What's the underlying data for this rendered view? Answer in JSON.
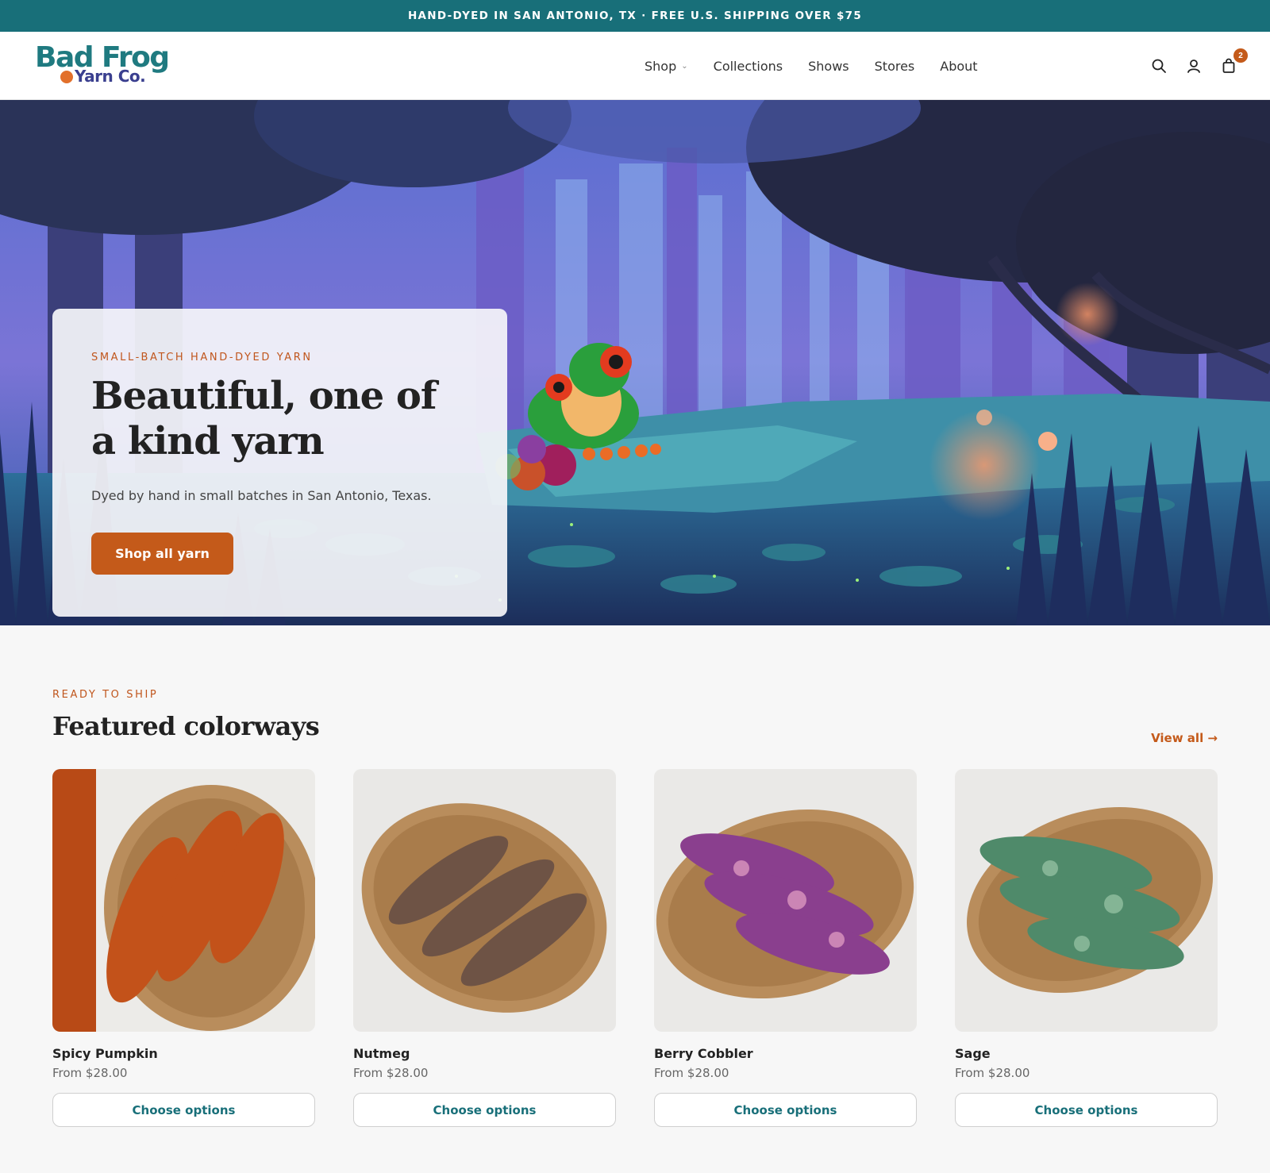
{
  "announcement": "HAND-DYED IN SAN ANTONIO, TX · FREE U.S. SHIPPING OVER $75",
  "brand": {
    "line1": "Bad Frog",
    "line2": "Yarn Co."
  },
  "nav": {
    "items": [
      {
        "label": "Shop",
        "has_dropdown": true
      },
      {
        "label": "Collections"
      },
      {
        "label": "Shows"
      },
      {
        "label": "Stores"
      },
      {
        "label": "About"
      }
    ]
  },
  "header_icons": {
    "search": "search-icon",
    "account": "user-icon",
    "cart": "bag-icon",
    "cart_count": "2"
  },
  "hero": {
    "eyebrow": "SMALL-BATCH HAND-DYED YARN",
    "title": "Beautiful, one of a kind yarn",
    "subtitle": "Dyed by hand in small batches in San Antonio, Texas.",
    "cta": "Shop all yarn"
  },
  "featured": {
    "eyebrow": "READY TO SHIP",
    "title": "Featured colorways",
    "view_all": "View all →",
    "products": [
      {
        "name": "Spicy Pumpkin",
        "price": "From $28.00",
        "button": "Choose options",
        "color": "#c3521a"
      },
      {
        "name": "Nutmeg",
        "price": "From $28.00",
        "button": "Choose options",
        "color": "#6e5345"
      },
      {
        "name": "Berry Cobbler",
        "price": "From $28.00",
        "button": "Choose options",
        "color": "#8a3f8e"
      },
      {
        "name": "Sage",
        "price": "From $28.00",
        "button": "Choose options",
        "color": "#4f8a6a"
      }
    ]
  },
  "colors": {
    "teal": "#186f79",
    "accent": "#c45a1a"
  }
}
